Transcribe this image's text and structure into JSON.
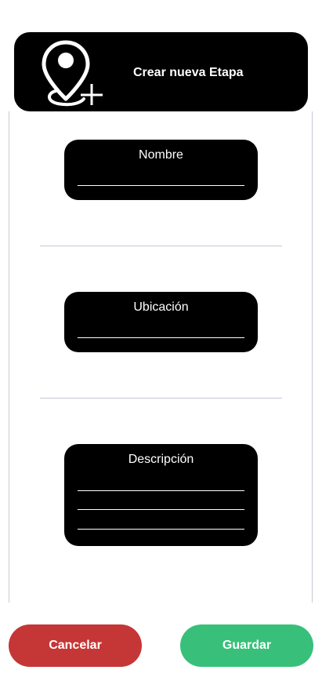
{
  "header": {
    "title": "Crear nueva Etapa",
    "icon": "map-pin-add-icon"
  },
  "form": {
    "fields": [
      {
        "label": "Nombre",
        "value": ""
      },
      {
        "label": "Ubicación",
        "value": ""
      },
      {
        "label": "Descripción",
        "value": ""
      }
    ]
  },
  "actions": {
    "cancel_label": "Cancelar",
    "save_label": "Guardar"
  },
  "colors": {
    "header_bg": "#000000",
    "field_bg": "#000000",
    "cancel": "#c53636",
    "save": "#38c07a",
    "divider": "#c6c6d8"
  }
}
